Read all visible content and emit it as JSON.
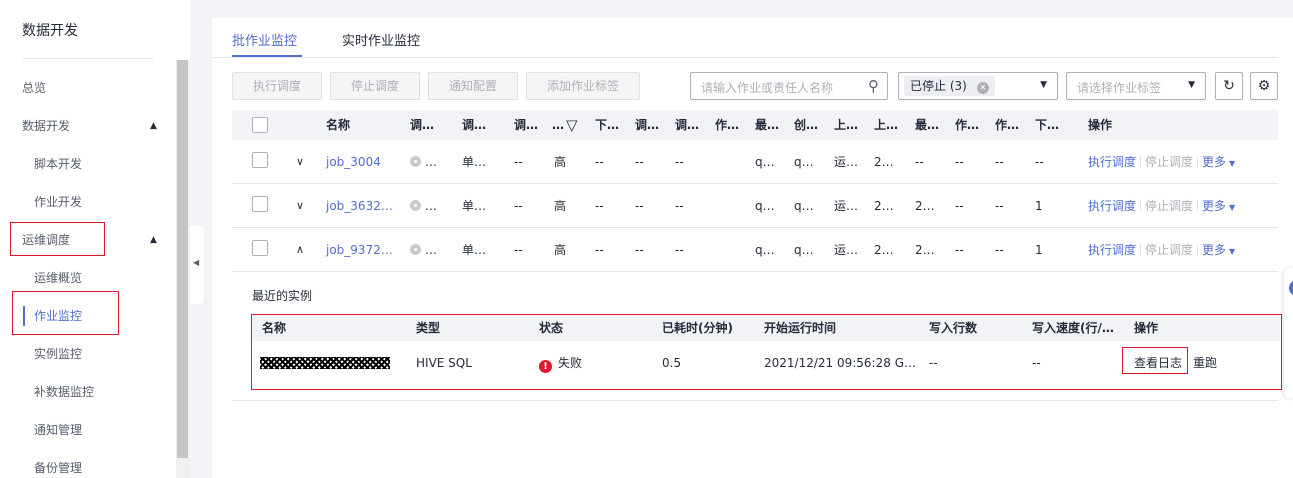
{
  "sidebar": {
    "title": "数据开发",
    "items": [
      {
        "label": "总览"
      },
      {
        "label": "数据开发"
      },
      {
        "label": "脚本开发"
      },
      {
        "label": "作业开发"
      },
      {
        "label": "运维调度"
      },
      {
        "label": "运维概览"
      },
      {
        "label": "作业监控"
      },
      {
        "label": "实例监控"
      },
      {
        "label": "补数据监控"
      },
      {
        "label": "通知管理"
      },
      {
        "label": "备份管理"
      }
    ]
  },
  "tabs": [
    {
      "label": "批作业监控"
    },
    {
      "label": "实时作业监控"
    }
  ],
  "toolbar": {
    "buttons": [
      "执行调度",
      "停止调度",
      "通知配置",
      "添加作业标签"
    ],
    "search_placeholder": "请输入作业或责任人名称",
    "status_filter": "已停止 (3)",
    "tag_placeholder": "请选择作业标签"
  },
  "table": {
    "headers": [
      "名称",
      "调…",
      "调…",
      "调…",
      "…",
      "下…",
      "调…",
      "调…",
      "作…",
      "最…",
      "创…",
      "上…",
      "上…",
      "最…",
      "作…",
      "作…",
      "下…",
      "操作"
    ],
    "rows": [
      {
        "name": "job_3004",
        "status": "…",
        "c2": "单…",
        "c3": "--",
        "c4": "高",
        "c5": "--",
        "c6": "--",
        "c7": "--",
        "c9": "q…",
        "c10": "q…",
        "c11": "运…",
        "c12": "2…",
        "c13": "--",
        "c14": "--",
        "c15": "--",
        "c16": "--",
        "expanded": false
      },
      {
        "name": "job_3632…",
        "status": "…",
        "c2": "单…",
        "c3": "--",
        "c4": "高",
        "c5": "--",
        "c6": "--",
        "c7": "--",
        "c9": "q…",
        "c10": "q…",
        "c11": "运…",
        "c12": "2…",
        "c13": "2…",
        "c14": "--",
        "c15": "--",
        "c16": "1",
        "expanded": false
      },
      {
        "name": "job_9372…",
        "status": "…",
        "c2": "单…",
        "c3": "--",
        "c4": "高",
        "c5": "--",
        "c6": "--",
        "c7": "--",
        "c9": "q…",
        "c10": "q…",
        "c11": "运…",
        "c12": "2…",
        "c13": "2…",
        "c14": "--",
        "c15": "--",
        "c16": "1",
        "expanded": true
      }
    ],
    "actions": {
      "run": "执行调度",
      "stop": "停止调度",
      "more": "更多"
    }
  },
  "instances": {
    "title": "最近的实例",
    "headers": [
      "名称",
      "类型",
      "状态",
      "已耗时(分钟)",
      "开始运行时间",
      "写入行数",
      "写入速度(行/…",
      "操作"
    ],
    "row": {
      "type": "HIVE SQL",
      "status": "失败",
      "elapsed": "0.5",
      "start_time": "2021/12/21 09:56:28 G…",
      "rows_written": "--",
      "write_speed": "--",
      "view_log": "查看日志",
      "rerun": "重跑"
    }
  },
  "colors": {
    "accent": "#526ecc",
    "highlight_border": "#e0182d",
    "fail": "#e0182d"
  }
}
